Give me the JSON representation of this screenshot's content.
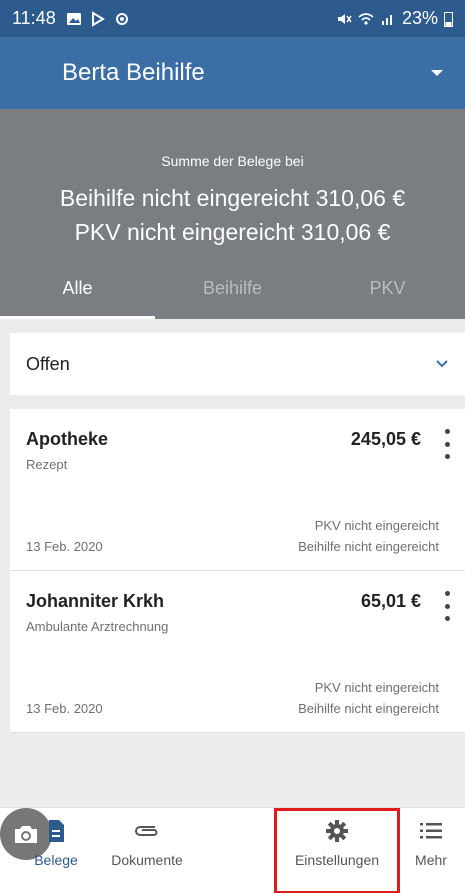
{
  "status_bar": {
    "time": "11:48",
    "battery": "23%"
  },
  "app_bar": {
    "title": "Berta Beihilfe",
    "dropdown_icon": "caret-down-icon"
  },
  "summary": {
    "caption": "Summe der Belege bei",
    "line1": "Beihilfe nicht eingereicht 310,06 €",
    "line2": "PKV nicht eingereicht 310,06 €"
  },
  "tabs": [
    {
      "label": "Alle",
      "active": true
    },
    {
      "label": "Beihilfe",
      "active": false
    },
    {
      "label": "PKV",
      "active": false
    }
  ],
  "filter": {
    "label": "Offen"
  },
  "receipts": [
    {
      "name": "Apotheke",
      "category": "Rezept",
      "amount": "245,05 €",
      "date": "13 Feb. 2020",
      "status_pkv": "PKV nicht eingereicht",
      "status_beihilfe": "Beihilfe nicht eingereicht"
    },
    {
      "name": "Johanniter Krkh",
      "category": "Ambulante Arztrechnung",
      "amount": "65,01 €",
      "date": "13 Feb. 2020",
      "status_pkv": "PKV nicht eingereicht",
      "status_beihilfe": "Beihilfe nicht eingereicht"
    }
  ],
  "bottom_nav": {
    "belege": "Belege",
    "dokumente": "Dokumente",
    "einstellungen": "Einstellungen",
    "mehr": "Mehr"
  },
  "colors": {
    "primary": "#3a6ea5",
    "status_bar": "#2d5b8e",
    "summary_bg": "#7a7e82",
    "highlight": "#e01b1b"
  }
}
